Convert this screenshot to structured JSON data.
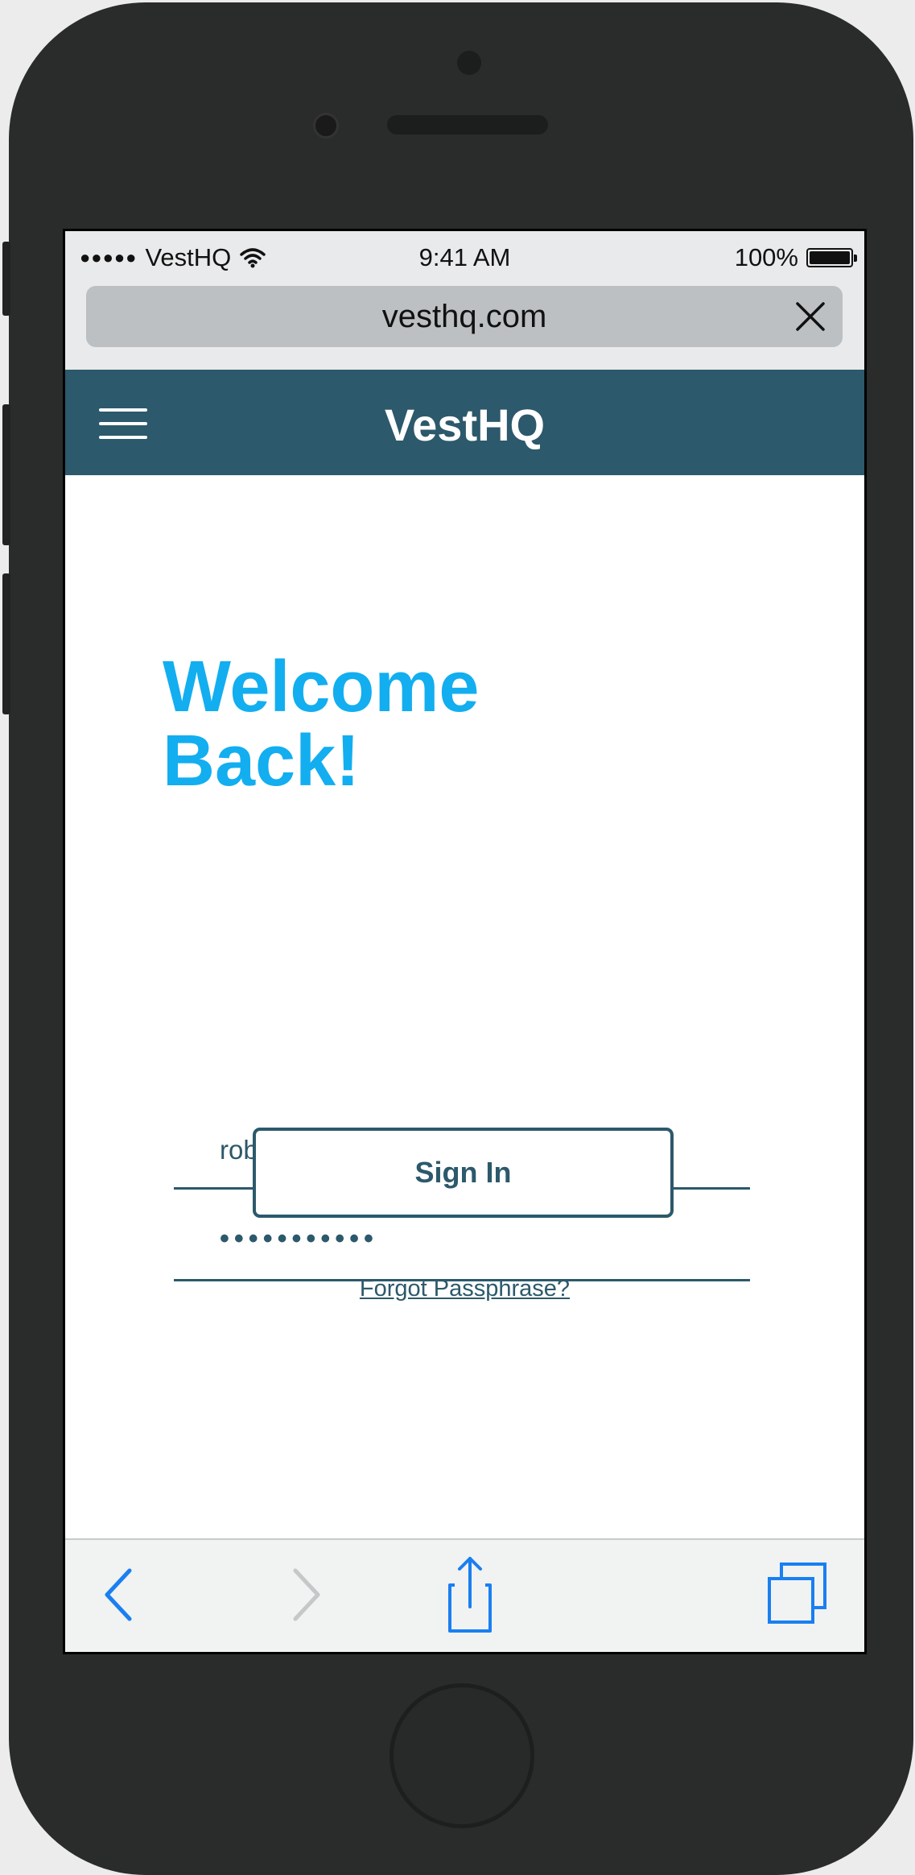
{
  "status_bar": {
    "carrier_dots": "●●●●●",
    "carrier": "VestHQ",
    "time": "9:41 AM",
    "battery_percent": "100%"
  },
  "browser": {
    "url": "vesthq.com"
  },
  "header": {
    "brand": "VestHQ"
  },
  "login": {
    "title_line1": "Welcome",
    "title_line2": "Back!",
    "email_value": "rob123@email.com",
    "password_mask": "•••••••••••",
    "signin_label": "Sign In",
    "forgot_label": "Forgot Passphrase?"
  },
  "colors": {
    "header_bg": "#2c596b",
    "accent": "#12aef0",
    "toolbar_icon": "#1a7ff0",
    "toolbar_icon_disabled": "#c5c7c8"
  },
  "icons": {
    "menu": "hamburger-icon",
    "close": "close-icon",
    "wifi": "wifi-icon",
    "battery": "battery-icon",
    "back": "chevron-left-icon",
    "forward": "chevron-right-icon",
    "share": "share-icon",
    "tabs": "tabs-icon"
  }
}
